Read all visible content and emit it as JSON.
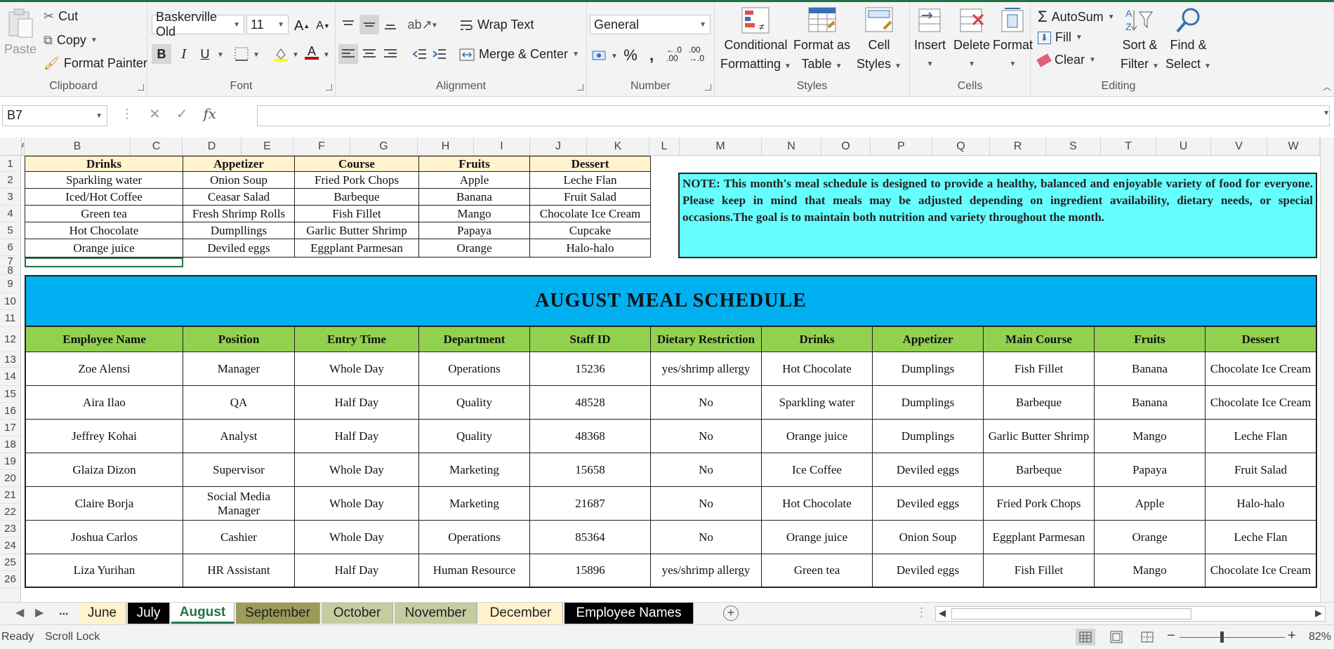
{
  "ribbon": {
    "clipboard": {
      "label": "Clipboard",
      "paste": "Paste",
      "cut": "Cut",
      "copy": "Copy",
      "format_painter": "Format Painter"
    },
    "font": {
      "label": "Font",
      "font_name": "Baskerville Old",
      "font_size": "11"
    },
    "alignment": {
      "label": "Alignment",
      "wrap_text": "Wrap Text",
      "merge_center": "Merge & Center"
    },
    "number": {
      "label": "Number",
      "format": "General"
    },
    "styles": {
      "label": "Styles",
      "conditional_1": "Conditional",
      "conditional_2": "Formatting",
      "format_table_1": "Format as",
      "format_table_2": "Table",
      "cell_styles_1": "Cell",
      "cell_styles_2": "Styles"
    },
    "cells": {
      "label": "Cells",
      "insert": "Insert",
      "delete": "Delete",
      "format": "Format"
    },
    "editing": {
      "label": "Editing",
      "autosum": "AutoSum",
      "fill": "Fill",
      "clear": "Clear",
      "sort_1": "Sort &",
      "sort_2": "Filter",
      "find_1": "Find &",
      "find_2": "Select"
    }
  },
  "formula_bar": {
    "name_box": "B7",
    "value": ""
  },
  "columns": [
    "A",
    "B",
    "C",
    "D",
    "E",
    "F",
    "G",
    "H",
    "I",
    "J",
    "K",
    "L",
    "M",
    "N",
    "O",
    "P",
    "Q",
    "R",
    "S",
    "T",
    "U",
    "V",
    "W"
  ],
  "rows": [
    "1",
    "2",
    "3",
    "4",
    "5",
    "6",
    "7",
    "8",
    "9",
    "10",
    "11",
    "12",
    "13",
    "14",
    "15",
    "16",
    "17",
    "18",
    "19",
    "20",
    "21",
    "22",
    "23",
    "24",
    "25",
    "26"
  ],
  "menu": {
    "headers": [
      "Drinks",
      "Appetizer",
      "Course",
      "Fruits",
      "Dessert"
    ],
    "rows": [
      [
        "Sparkling water",
        "Onion Soup",
        "Fried Pork Chops",
        "Apple",
        "Leche Flan"
      ],
      [
        "Iced/Hot Coffee",
        "Ceasar Salad",
        "Barbeque",
        "Banana",
        "Fruit Salad"
      ],
      [
        "Green tea",
        "Fresh Shrimp Rolls",
        "Fish Fillet",
        "Mango",
        "Chocolate Ice Cream"
      ],
      [
        "Hot Chocolate",
        "Dumpllings",
        "Garlic Butter Shrimp",
        "Papaya",
        "Cupcake"
      ],
      [
        "Orange juice",
        "Deviled eggs",
        "Eggplant Parmesan",
        "Orange",
        "Halo-halo"
      ]
    ]
  },
  "note": "NOTE: This month's meal schedule is designed to provide a healthy, balanced and enjoyable variety of food for everyone. Please keep in mind that meals may be adjusted depending on ingredient availability, dietary needs, or special occasions.The goal is to maintain both nutrition and variety throughout the month.",
  "banner_title": "AUGUST  MEAL SCHEDULE",
  "schedule": {
    "headers": [
      "Employee Name",
      "Position",
      "Entry Time",
      "Department",
      "Staff ID",
      "Dietary Restriction",
      "Drinks",
      "Appetizer",
      "Main Course",
      "Fruits",
      "Dessert"
    ],
    "rows": [
      [
        "Zoe Alensi",
        "Manager",
        "Whole Day",
        "Operations",
        "15236",
        "yes/shrimp allergy",
        "Hot Chocolate",
        "Dumplings",
        "Fish Fillet",
        "Banana",
        "Chocolate Ice Cream"
      ],
      [
        "Aira Ilao",
        "QA",
        "Half Day",
        "Quality",
        "48528",
        "No",
        "Sparkling water",
        "Dumplings",
        "Barbeque",
        "Banana",
        "Chocolate Ice Cream"
      ],
      [
        "Jeffrey Kohai",
        "Analyst",
        "Half Day",
        "Quality",
        "48368",
        "No",
        "Orange juice",
        "Dumplings",
        "Garlic Butter Shrimp",
        "Mango",
        "Leche Flan"
      ],
      [
        "Glaiza Dizon",
        "Supervisor",
        "Whole Day",
        "Marketing",
        "15658",
        "No",
        "Ice Coffee",
        "Deviled eggs",
        "Barbeque",
        "Papaya",
        "Fruit Salad"
      ],
      [
        "Claire Borja",
        "Social Media Manager",
        "Whole Day",
        "Marketing",
        "21687",
        "No",
        "Hot Chocolate",
        "Deviled eggs",
        "Fried Pork Chops",
        "Apple",
        "Halo-halo"
      ],
      [
        "Joshua Carlos",
        "Cashier",
        "Whole Day",
        "Operations",
        "85364",
        "No",
        "Orange juice",
        "Onion Soup",
        "Eggplant Parmesan",
        "Orange",
        "Leche Flan"
      ],
      [
        "Liza Yurihan",
        "HR Assistant",
        "Half Day",
        "Human Resource",
        "15896",
        "yes/shrimp allergy",
        "Green tea",
        "Deviled eggs",
        "Fish Fillet",
        "Mango",
        "Chocolate Ice Cream"
      ]
    ]
  },
  "tabs": [
    {
      "label": "June",
      "bg": "#fff2cc",
      "fg": "#222"
    },
    {
      "label": "July",
      "bg": "#000000",
      "fg": "#ffffff"
    },
    {
      "label": "August",
      "bg": "#ffffff",
      "fg": "#217346",
      "active": true
    },
    {
      "label": "September",
      "bg": "#9b9b5a",
      "fg": "#222"
    },
    {
      "label": "October",
      "bg": "#c4cca0",
      "fg": "#222"
    },
    {
      "label": "November",
      "bg": "#c4cca0",
      "fg": "#222"
    },
    {
      "label": "December",
      "bg": "#fff2cc",
      "fg": "#222"
    },
    {
      "label": "Employee Names",
      "bg": "#000000",
      "fg": "#ffffff"
    }
  ],
  "tab_overflow": "...",
  "status": {
    "ready": "Ready",
    "scroll_lock": "Scroll Lock",
    "zoom": "82%"
  },
  "colors": {
    "accent": "#217346",
    "menu_header": "#fff2cc",
    "note_bg": "#66ffff",
    "banner_bg": "#00b0f0",
    "table_header": "#92d050"
  }
}
